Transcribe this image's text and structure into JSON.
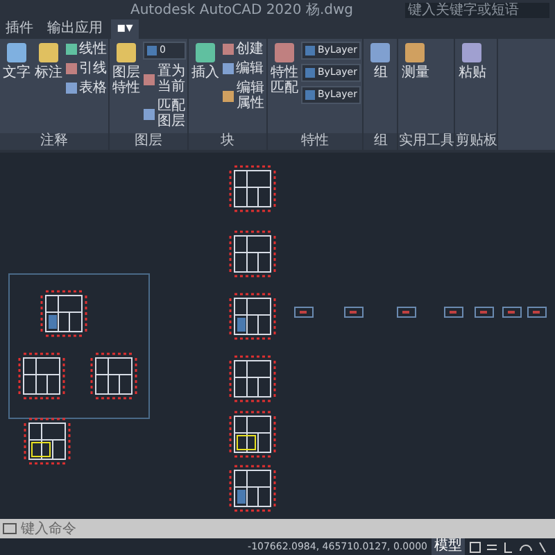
{
  "window": {
    "title": "Autodesk AutoCAD 2020  杨.dwg",
    "search": {
      "placeholder": "键入关键字或短语"
    }
  },
  "tabs": [
    {
      "label": "插件",
      "selected": false
    },
    {
      "label": "输出应用",
      "selected": false
    },
    {
      "label": "▪▾",
      "selected": true
    }
  ],
  "ribbon": [
    {
      "title": "注释",
      "tools": [
        {
          "kind": "large",
          "label": "文字"
        },
        {
          "kind": "large",
          "label": "标注"
        },
        {
          "kind": "small",
          "label": "线性"
        },
        {
          "kind": "small",
          "label": "引线"
        },
        {
          "kind": "small",
          "label": "表格"
        }
      ]
    },
    {
      "title": "图层",
      "tools": [
        {
          "kind": "large",
          "label": "图层特性"
        },
        {
          "kind": "dropdown",
          "label": "0"
        },
        {
          "kind": "small",
          "label": "置为当前"
        },
        {
          "kind": "small",
          "label": "匹配图层"
        }
      ]
    },
    {
      "title": "块",
      "tools": [
        {
          "kind": "large",
          "label": "插入"
        },
        {
          "kind": "small",
          "label": "创建"
        },
        {
          "kind": "small",
          "label": "编辑"
        },
        {
          "kind": "small",
          "label": "编辑属性"
        }
      ]
    },
    {
      "title": "特性",
      "tools": [
        {
          "kind": "large",
          "label": "特性匹配"
        },
        {
          "kind": "dropdown",
          "label": "ByLayer"
        },
        {
          "kind": "dropdown",
          "label": "ByLayer"
        },
        {
          "kind": "dropdown",
          "label": "ByLayer"
        }
      ]
    },
    {
      "title": "组",
      "tools": [
        {
          "kind": "large",
          "label": "组"
        }
      ]
    },
    {
      "title": "实用工具",
      "tools": [
        {
          "kind": "large",
          "label": "测量"
        }
      ]
    },
    {
      "title": "剪贴板",
      "tools": [
        {
          "kind": "large",
          "label": "粘贴"
        }
      ]
    }
  ],
  "command_line": {
    "placeholder": "键入命令"
  },
  "status_bar": {
    "coordinates": "-107662.0984, 465710.0127, 0.0000",
    "mode": "模型"
  }
}
